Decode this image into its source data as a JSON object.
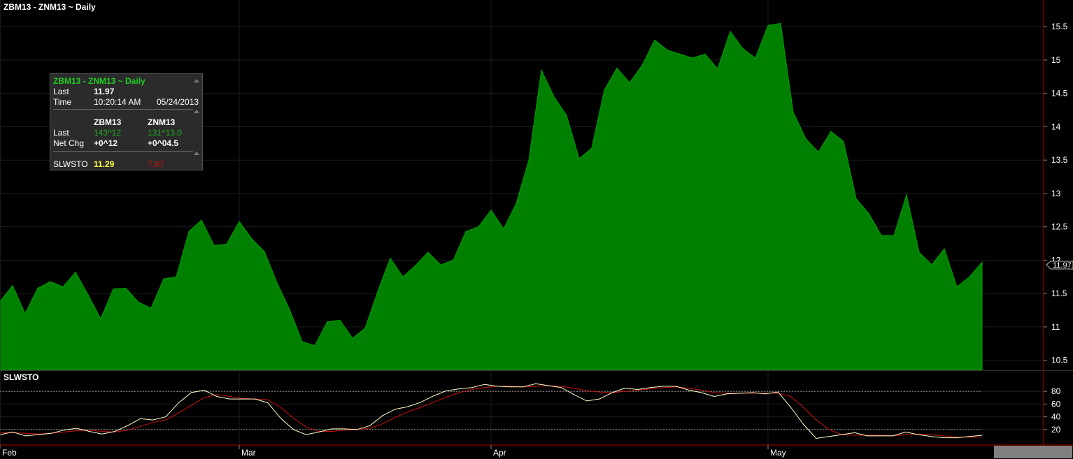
{
  "chart_title": "ZBM13 - ZNM13 ~ Daily",
  "colors": {
    "area_fill": "#008000",
    "area_line": "#00a000",
    "stoch_k": "#ffffcc",
    "stoch_d": "#cc1111",
    "grid": "#1e1e1e",
    "frame": "#b00000"
  },
  "data_window": {
    "title": "ZBM13 - ZNM13 ~ Daily",
    "last_label": "Last",
    "last_value": "11.97",
    "time_label": "Time",
    "time_value": "10:20:14 AM",
    "date_value": "05/24/2013",
    "col1_header": "ZBM13",
    "col2_header": "ZNM13",
    "row_last_label": "Last",
    "zb_last": "143^12",
    "zn_last": "131^13.0",
    "row_netchg_label": "Net Chg",
    "zb_netchg": "+0^12",
    "zn_netchg": "+0^04.5",
    "slwsto_label": "SLWSTO",
    "slwsto_k": "11.29",
    "slwsto_d": "7.87"
  },
  "indicator": {
    "name": "SLWSTO",
    "y_ticks": [
      "20",
      "40",
      "60",
      "80"
    ],
    "levels": [
      20,
      80
    ]
  },
  "last_price_tag": "11.97",
  "chart_data": [
    {
      "type": "area",
      "title": "ZBM13 - ZNM13 ~ Daily",
      "x_labels": [
        "Feb",
        "Mar",
        "Apr",
        "May"
      ],
      "x_label_index": [
        0,
        19,
        39,
        61
      ],
      "y_ticks": [
        "10.5",
        "11",
        "11.5",
        "12",
        "12.5",
        "13",
        "13.5",
        "14",
        "14.5",
        "15",
        "15.5"
      ],
      "ylim": [
        10.35,
        15.9
      ],
      "values": [
        11.38,
        11.62,
        11.2,
        11.58,
        11.68,
        11.6,
        11.82,
        11.48,
        11.12,
        11.57,
        11.58,
        11.37,
        11.28,
        11.72,
        11.75,
        12.43,
        12.6,
        12.22,
        12.24,
        12.58,
        12.32,
        12.13,
        11.66,
        11.26,
        10.78,
        10.72,
        11.08,
        11.1,
        10.83,
        10.98,
        11.53,
        12.03,
        11.75,
        11.92,
        12.12,
        11.93,
        12.0,
        12.43,
        12.5,
        12.75,
        12.47,
        12.85,
        13.5,
        14.85,
        14.45,
        14.17,
        13.52,
        13.68,
        14.55,
        14.88,
        14.66,
        14.92,
        15.3,
        15.15,
        15.09,
        15.03,
        15.09,
        14.87,
        15.43,
        15.17,
        15.03,
        15.52,
        15.55,
        14.22,
        13.82,
        13.62,
        13.93,
        13.78,
        12.92,
        12.7,
        12.37,
        12.37,
        12.98,
        12.12,
        11.93,
        12.17,
        11.6,
        11.75,
        11.97
      ]
    },
    {
      "type": "line",
      "title": "SLWSTO",
      "ylim": [
        0,
        100
      ],
      "series": [
        {
          "values": [
            12,
            16,
            10,
            12,
            14,
            19,
            22,
            17,
            13,
            17,
            26,
            37,
            35,
            40,
            62,
            78,
            82,
            72,
            68,
            68,
            68,
            62,
            38,
            20,
            12,
            16,
            21,
            21,
            20,
            26,
            42,
            52,
            56,
            63,
            73,
            81,
            84,
            86,
            91,
            88,
            87,
            87,
            92,
            89,
            86,
            75,
            65,
            68,
            78,
            85,
            83,
            86,
            88,
            88,
            82,
            78,
            72,
            76,
            77,
            78,
            76,
            79,
            55,
            28,
            6,
            9,
            12,
            15,
            10,
            10,
            10,
            16,
            12,
            9,
            7,
            7,
            9,
            11
          ]
        },
        {
          "values": [
            15,
            15,
            14,
            13,
            14,
            16,
            18,
            19,
            17,
            16,
            19,
            25,
            31,
            35,
            46,
            58,
            70,
            75,
            72,
            69,
            68,
            67,
            55,
            38,
            24,
            17,
            17,
            19,
            20,
            22,
            29,
            39,
            48,
            55,
            63,
            71,
            78,
            83,
            86,
            88,
            88,
            87,
            88,
            89,
            88,
            85,
            81,
            79,
            78,
            80,
            82,
            84,
            86,
            87,
            85,
            82,
            78,
            77,
            77,
            77,
            77,
            77,
            72,
            55,
            35,
            20,
            12,
            11,
            11,
            11,
            10,
            12,
            13,
            12,
            10,
            8,
            8,
            8
          ]
        }
      ]
    }
  ]
}
